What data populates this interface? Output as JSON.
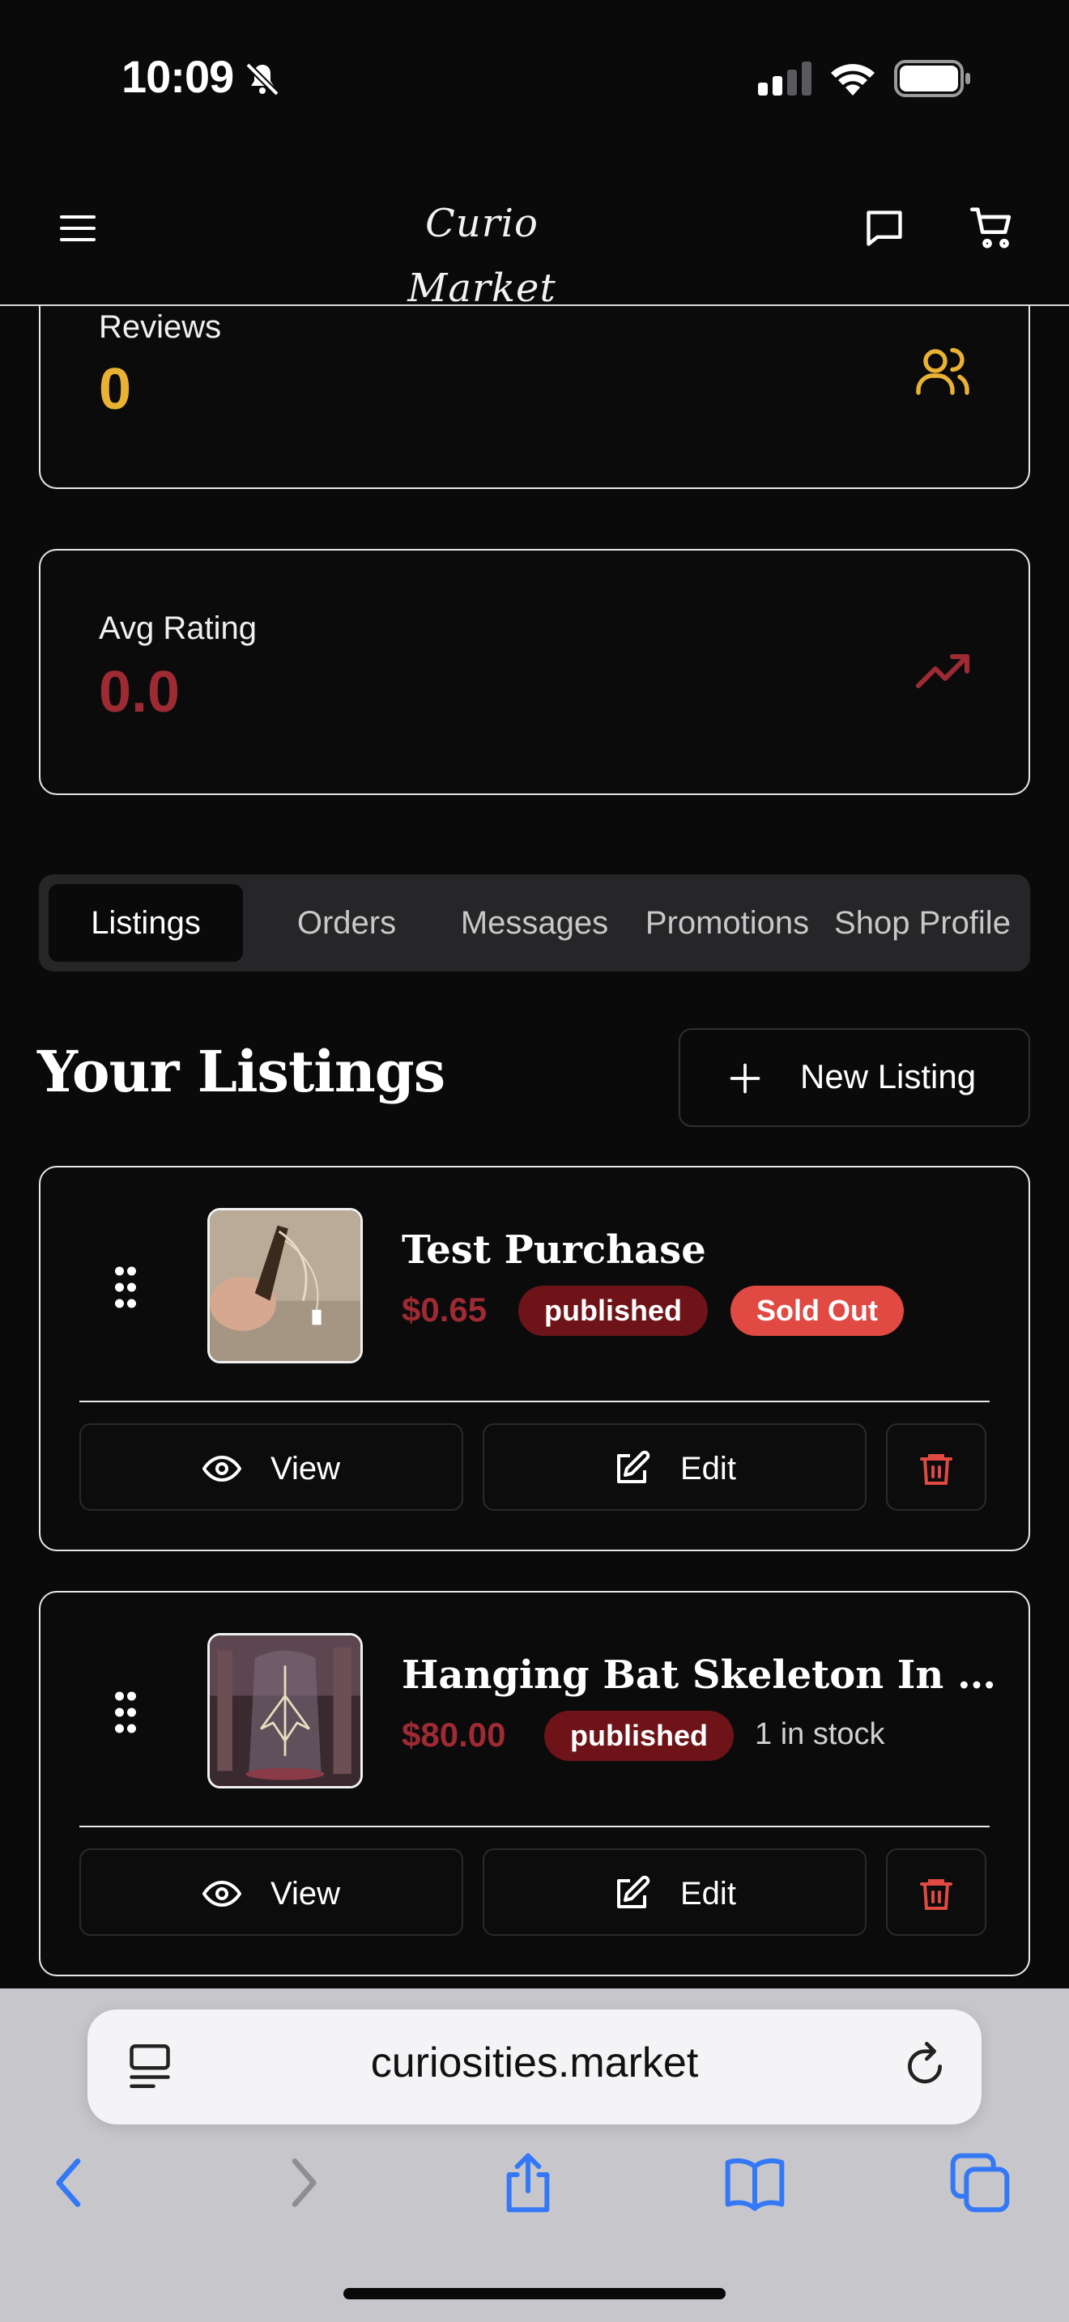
{
  "status_bar": {
    "time": "10:09"
  },
  "header": {
    "logo": "Curio Market"
  },
  "stats": {
    "reviews": {
      "label": "Reviews",
      "value": "0",
      "color": "#e9b234"
    },
    "avg_rating": {
      "label": "Avg Rating",
      "value": "0.0",
      "color": "#9e2a33"
    }
  },
  "tabs": [
    {
      "label": "Listings",
      "active": true
    },
    {
      "label": "Orders"
    },
    {
      "label": "Messages"
    },
    {
      "label": "Promotions"
    },
    {
      "label": "Shop Profile"
    }
  ],
  "section": {
    "title": "Your Listings",
    "new_listing_label": "New Listing"
  },
  "listings": [
    {
      "title": "Test Purchase",
      "price": "$0.65",
      "status": "published",
      "badge": "Sold Out",
      "view_label": "View",
      "edit_label": "Edit"
    },
    {
      "title": "Hanging Bat Skeleton In a Glas...",
      "price": "$80.00",
      "status": "published",
      "stock": "1 in stock",
      "view_label": "View",
      "edit_label": "Edit"
    }
  ],
  "browser": {
    "url": "curiosities.market"
  },
  "colors": {
    "accent_red": "#9e2a33",
    "accent_gold": "#e9b234",
    "ios_blue": "#3478f6"
  }
}
